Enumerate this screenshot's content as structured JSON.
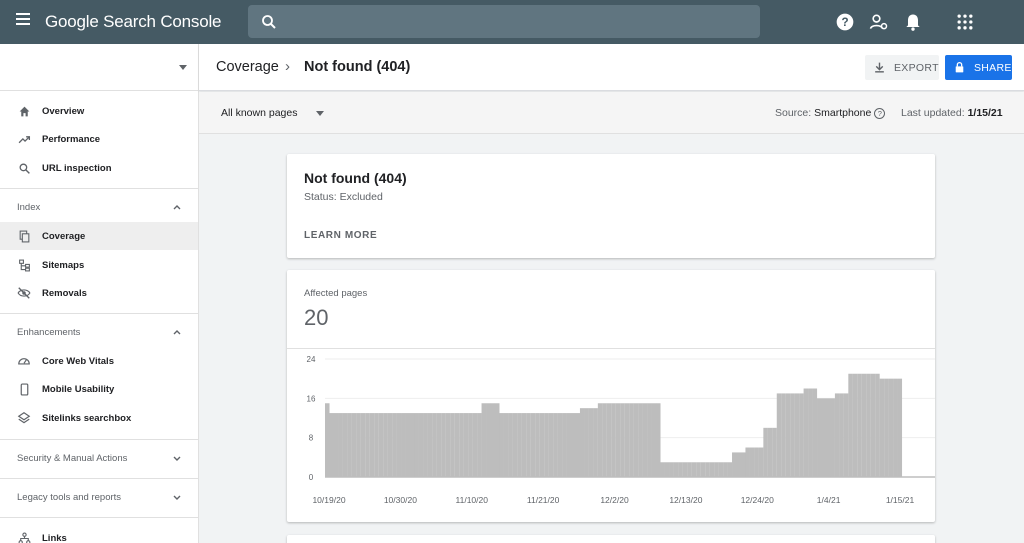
{
  "app": {
    "title": "Google Search Console"
  },
  "sidebar": {
    "top_items": [
      {
        "label": "Overview",
        "icon": "home-icon"
      },
      {
        "label": "Performance",
        "icon": "trending-up-icon"
      },
      {
        "label": "URL inspection",
        "icon": "search-icon"
      }
    ],
    "index": {
      "title": "Index",
      "items": [
        {
          "label": "Coverage",
          "icon": "coverage-icon",
          "active": true
        },
        {
          "label": "Sitemaps",
          "icon": "sitemap-icon"
        },
        {
          "label": "Removals",
          "icon": "eye-off-icon"
        }
      ]
    },
    "enhancements": {
      "title": "Enhancements",
      "items": [
        {
          "label": "Core Web Vitals",
          "icon": "gauge-icon"
        },
        {
          "label": "Mobile Usability",
          "icon": "phone-icon"
        },
        {
          "label": "Sitelinks searchbox",
          "icon": "layers-icon"
        }
      ]
    },
    "security_title": "Security & Manual Actions",
    "legacy_title": "Legacy tools and reports",
    "links_label": "Links"
  },
  "header": {
    "breadcrumb_parent": "Coverage",
    "breadcrumb_separator": "›",
    "breadcrumb_current": "Not found (404)",
    "export_label": "EXPORT",
    "share_label": "SHARE"
  },
  "filter": {
    "selected": "All known pages",
    "source_label": "Source:",
    "source_value": "Smartphone",
    "updated_label": "Last updated:",
    "updated_value": "1/15/21"
  },
  "issue_card": {
    "title": "Not found (404)",
    "status": "Status: Excluded",
    "learn_more": "LEARN MORE"
  },
  "metric": {
    "label": "Affected pages",
    "value": "20"
  },
  "colors": {
    "topbar": "#455a64",
    "accent": "#1a73e8",
    "bar": "#bdbdbd"
  },
  "chart_data": {
    "type": "bar",
    "ylim": [
      0,
      24
    ],
    "yticks": [
      "0",
      "8",
      "16",
      "24"
    ],
    "xtick_labels": [
      "10/19/20",
      "10/30/20",
      "11/10/20",
      "11/21/20",
      "12/2/20",
      "12/13/20",
      "12/24/20",
      "1/4/21",
      "1/15/21"
    ],
    "values": [
      15,
      13,
      13,
      13,
      13,
      13,
      13,
      13,
      13,
      13,
      13,
      13,
      13,
      13,
      13,
      13,
      13,
      13,
      13,
      13,
      13,
      13,
      13,
      13,
      13,
      13,
      13,
      13,
      13,
      13,
      13,
      13,
      13,
      13,
      13,
      15,
      15,
      15,
      15,
      13,
      13,
      13,
      13,
      13,
      13,
      13,
      13,
      13,
      13,
      13,
      13,
      13,
      13,
      13,
      13,
      13,
      13,
      14,
      14,
      14,
      14,
      15,
      15,
      15,
      15,
      15,
      15,
      15,
      15,
      15,
      15,
      15,
      15,
      15,
      15,
      3,
      3,
      3,
      3,
      3,
      3,
      3,
      3,
      3,
      3,
      3,
      3,
      3,
      3,
      3,
      3,
      5,
      5,
      5,
      6,
      6,
      6,
      6,
      10,
      10,
      10,
      17,
      17,
      17,
      17,
      17,
      17,
      18,
      18,
      18,
      16,
      16,
      16,
      16,
      17,
      17,
      17,
      21,
      21,
      21,
      21,
      21,
      21,
      21,
      20,
      20,
      20,
      20,
      20
    ]
  }
}
